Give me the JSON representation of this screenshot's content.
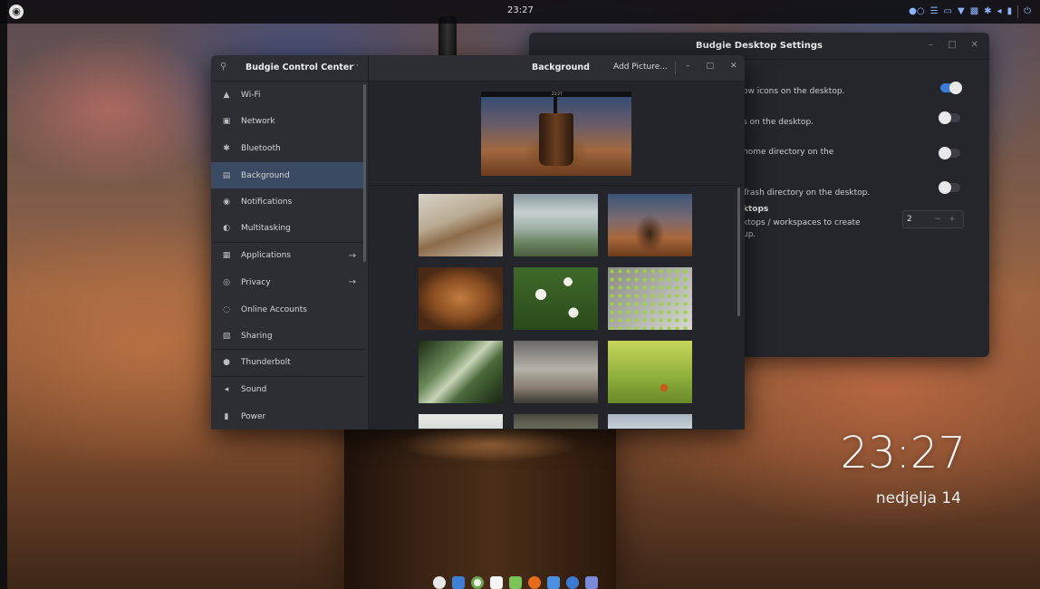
{
  "top_panel": {
    "clock": "23:27"
  },
  "desktop_settings": {
    "title": "Budgie Desktop Settings",
    "rows": [
      {
        "text": "ow icons on the desktop.",
        "enabled": true
      },
      {
        "text": "s on the desktop.",
        "enabled": false
      },
      {
        "text": "home directory on the",
        "enabled": false
      },
      {
        "text": "Trash directory on the desktop.",
        "enabled": false
      }
    ],
    "workspaces": {
      "heading": "ktops",
      "line1": "ktops / workspaces to create",
      "line2": "up.",
      "value": "2",
      "minus": "−",
      "plus": "+"
    },
    "colors": {
      "accent": "#3b7bd5"
    }
  },
  "control_center": {
    "sidebar_title": "Budgie Control Center",
    "items": [
      {
        "label": "Wi-Fi",
        "icon": "wifi-icon",
        "glyph": "▲"
      },
      {
        "label": "Network",
        "icon": "network-icon",
        "glyph": "▣"
      },
      {
        "label": "Bluetooth",
        "icon": "bluetooth-icon",
        "glyph": "✱"
      },
      {
        "label": "Background",
        "icon": "background-icon",
        "glyph": "▤"
      },
      {
        "label": "Notifications",
        "icon": "notifications-icon",
        "glyph": "◉"
      },
      {
        "label": "Multitasking",
        "icon": "multitasking-icon",
        "glyph": "◐"
      },
      {
        "label": "Applications",
        "icon": "applications-icon",
        "glyph": "▦"
      },
      {
        "label": "Privacy",
        "icon": "privacy-icon",
        "glyph": "◎"
      },
      {
        "label": "Online Accounts",
        "icon": "online-accounts-icon",
        "glyph": "◌"
      },
      {
        "label": "Sharing",
        "icon": "sharing-icon",
        "glyph": "▧"
      },
      {
        "label": "Thunderbolt",
        "icon": "thunderbolt-icon",
        "glyph": "●"
      },
      {
        "label": "Sound",
        "icon": "sound-icon",
        "glyph": "◂"
      },
      {
        "label": "Power",
        "icon": "power-icon",
        "glyph": "▮"
      }
    ],
    "selected_item": "Background",
    "page_title": "Background",
    "add_picture": "Add Picture...",
    "preview_clock": "23:27",
    "wallpapers": [
      "anchor-beach",
      "sea-clouds",
      "iced-coffee",
      "tree-rings",
      "daisies",
      "dotted-metal",
      "fern",
      "misty-forest",
      "ladybug",
      "wallpaper-10",
      "wallpaper-11",
      "wallpaper-12"
    ]
  },
  "desktop_clock": {
    "time": "23:27",
    "date": "nedjelja 14"
  }
}
